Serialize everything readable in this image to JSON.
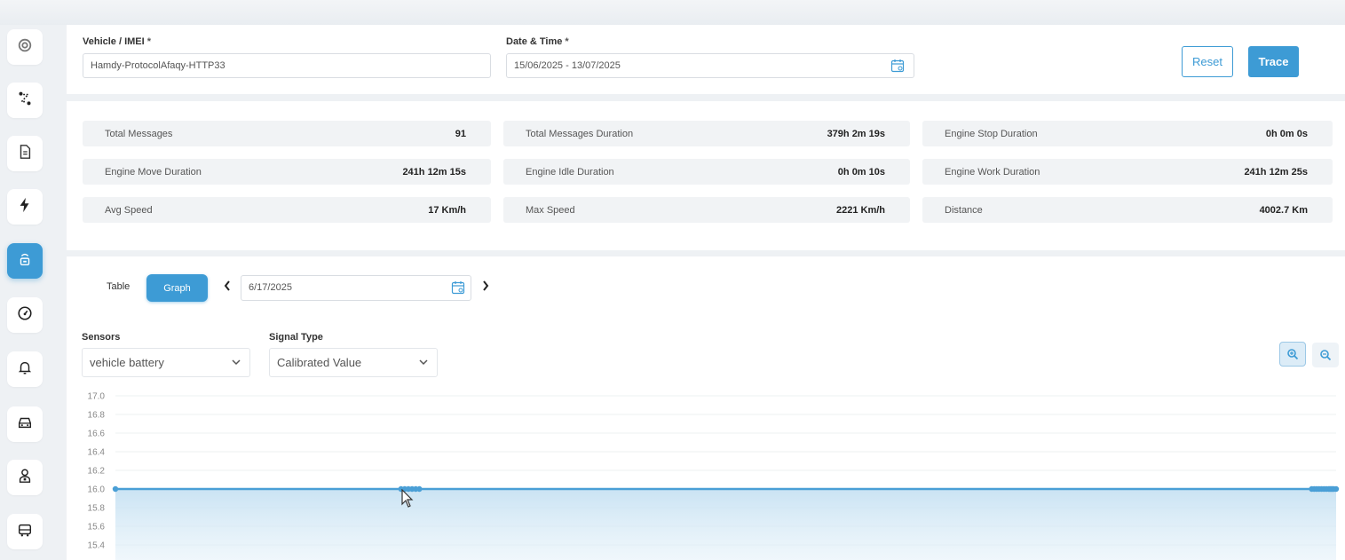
{
  "sidebar": {
    "items": [
      {
        "icon": "dashboard-icon",
        "active": false
      },
      {
        "icon": "route-icon",
        "active": false
      },
      {
        "icon": "document-icon",
        "active": false
      },
      {
        "icon": "lightning-icon",
        "active": false
      },
      {
        "icon": "sensor-icon",
        "active": true
      },
      {
        "icon": "speedometer-icon",
        "active": false
      },
      {
        "icon": "bell-icon",
        "active": false
      },
      {
        "icon": "car-icon",
        "active": false
      },
      {
        "icon": "driver-icon",
        "active": false
      },
      {
        "icon": "bus-icon",
        "active": false
      }
    ]
  },
  "form": {
    "vehicle_label": "Vehicle / IMEI",
    "vehicle_value": "Hamdy-ProtocolAfaqy-HTTP33",
    "date_label": "Date & Time",
    "date_value": "15/06/2025 - 13/07/2025",
    "required_mark": "*",
    "reset_label": "Reset",
    "trace_label": "Trace"
  },
  "stats": [
    {
      "label": "Total Messages",
      "value": "91"
    },
    {
      "label": "Total Messages Duration",
      "value": "379h 2m 19s"
    },
    {
      "label": "Engine Stop Duration",
      "value": "0h 0m 0s"
    },
    {
      "label": "Engine Move Duration",
      "value": "241h 12m 15s"
    },
    {
      "label": "Engine Idle Duration",
      "value": "0h 0m 10s"
    },
    {
      "label": "Engine Work Duration",
      "value": "241h 12m 25s"
    },
    {
      "label": "Avg Speed",
      "value": "17 Km/h"
    },
    {
      "label": "Max Speed",
      "value": "2221 Km/h"
    },
    {
      "label": "Distance",
      "value": "4002.7 Km"
    }
  ],
  "view": {
    "tab_table": "Table",
    "tab_graph": "Graph",
    "active_tab": "Graph",
    "prev_label": "‹",
    "next_label": "›",
    "date_value": "6/17/2025",
    "sensors_label": "Sensors",
    "sensors_value": "vehicle battery",
    "signal_label": "Signal Type",
    "signal_value": "Calibrated Value",
    "caret": "⌄"
  },
  "colors": {
    "accent": "#3d9bd5",
    "line": "#4a9fd6"
  },
  "chart_data": {
    "type": "area",
    "title": "",
    "xlabel": "",
    "ylabel": "",
    "ylim": [
      15.4,
      17.0
    ],
    "y_ticks": [
      "17.0",
      "16.8",
      "16.6",
      "16.4",
      "16.2",
      "16.0",
      "15.8",
      "15.6",
      "15.4"
    ],
    "grid": true,
    "series": [
      {
        "values": [
          16.0,
          16.0,
          16.0,
          16.0,
          16.0,
          16.0,
          16.0,
          16.0,
          16.0,
          16.0,
          16.0,
          16.0,
          16.0,
          16.0,
          16.0,
          16.0,
          16.0,
          16.0,
          16.0,
          16.0
        ]
      }
    ],
    "x_positions": [
      0,
      0.234,
      0.237,
      0.24,
      0.243,
      0.246,
      0.249,
      0.98,
      0.982,
      0.984,
      0.986,
      0.988,
      0.99,
      0.992,
      0.994,
      0.995,
      0.996,
      0.997,
      0.998,
      1.0
    ]
  }
}
